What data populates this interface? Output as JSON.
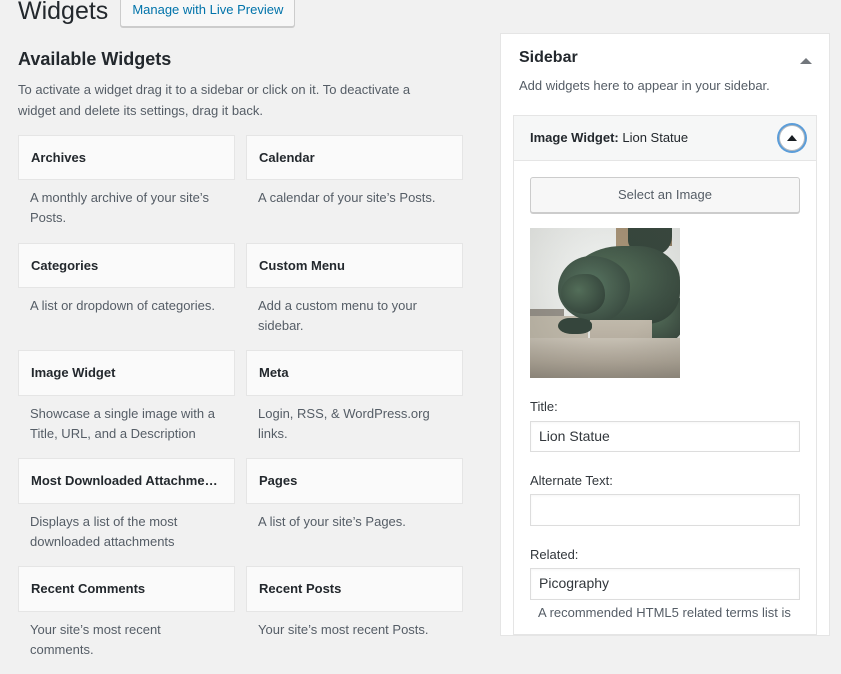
{
  "header": {
    "title": "Widgets",
    "live_preview_label": "Manage with Live Preview"
  },
  "available_widgets": {
    "heading": "Available Widgets",
    "description": "To activate a widget drag it to a sidebar or click on it. To deactivate a widget and delete its settings, drag it back.",
    "items": [
      {
        "title": "Archives",
        "description": "A monthly archive of your site’s Posts."
      },
      {
        "title": "Calendar",
        "description": "A calendar of your site’s Posts."
      },
      {
        "title": "Categories",
        "description": "A list or dropdown of categories."
      },
      {
        "title": "Custom Menu",
        "description": "Add a custom menu to your sidebar."
      },
      {
        "title": "Image Widget",
        "description": "Showcase a single image with a Title, URL, and a Description"
      },
      {
        "title": "Meta",
        "description": "Login, RSS, & WordPress.org links."
      },
      {
        "title": "Most Downloaded Attachme…",
        "description": "Displays a list of the most downloaded attachments"
      },
      {
        "title": "Pages",
        "description": "A list of your site’s Pages."
      },
      {
        "title": "Recent Comments",
        "description": "Your site’s most recent comments."
      },
      {
        "title": "Recent Posts",
        "description": "Your site’s most recent Posts."
      }
    ]
  },
  "sidebar_panel": {
    "title": "Sidebar",
    "description": "Add widgets here to appear in your sidebar.",
    "collapse_icon": "triangle-up-icon",
    "widget": {
      "type_label": "Image Widget:",
      "name_label": " Lion Statue",
      "toggle_icon": "triangle-up-icon",
      "select_image_label": "Select an Image",
      "image_alt": "Bronze lion statue on stone pedestal",
      "fields": [
        {
          "label": "Title:",
          "value": "Lion Statue",
          "help": ""
        },
        {
          "label": "Alternate Text:",
          "value": "",
          "help": ""
        },
        {
          "label": "Related:",
          "value": "Picography",
          "help": "A recommended HTML5 related terms list is"
        }
      ]
    }
  },
  "colors": {
    "page_background": "#f1f1f1",
    "panel_background": "#ffffff",
    "widget_box_background": "#fafafa",
    "link_blue": "#0073aa",
    "focus_ring_blue": "#5b9dd9",
    "text_dark": "#23282d",
    "text_muted": "#555d66",
    "border_grey": "#e5e5e5"
  }
}
